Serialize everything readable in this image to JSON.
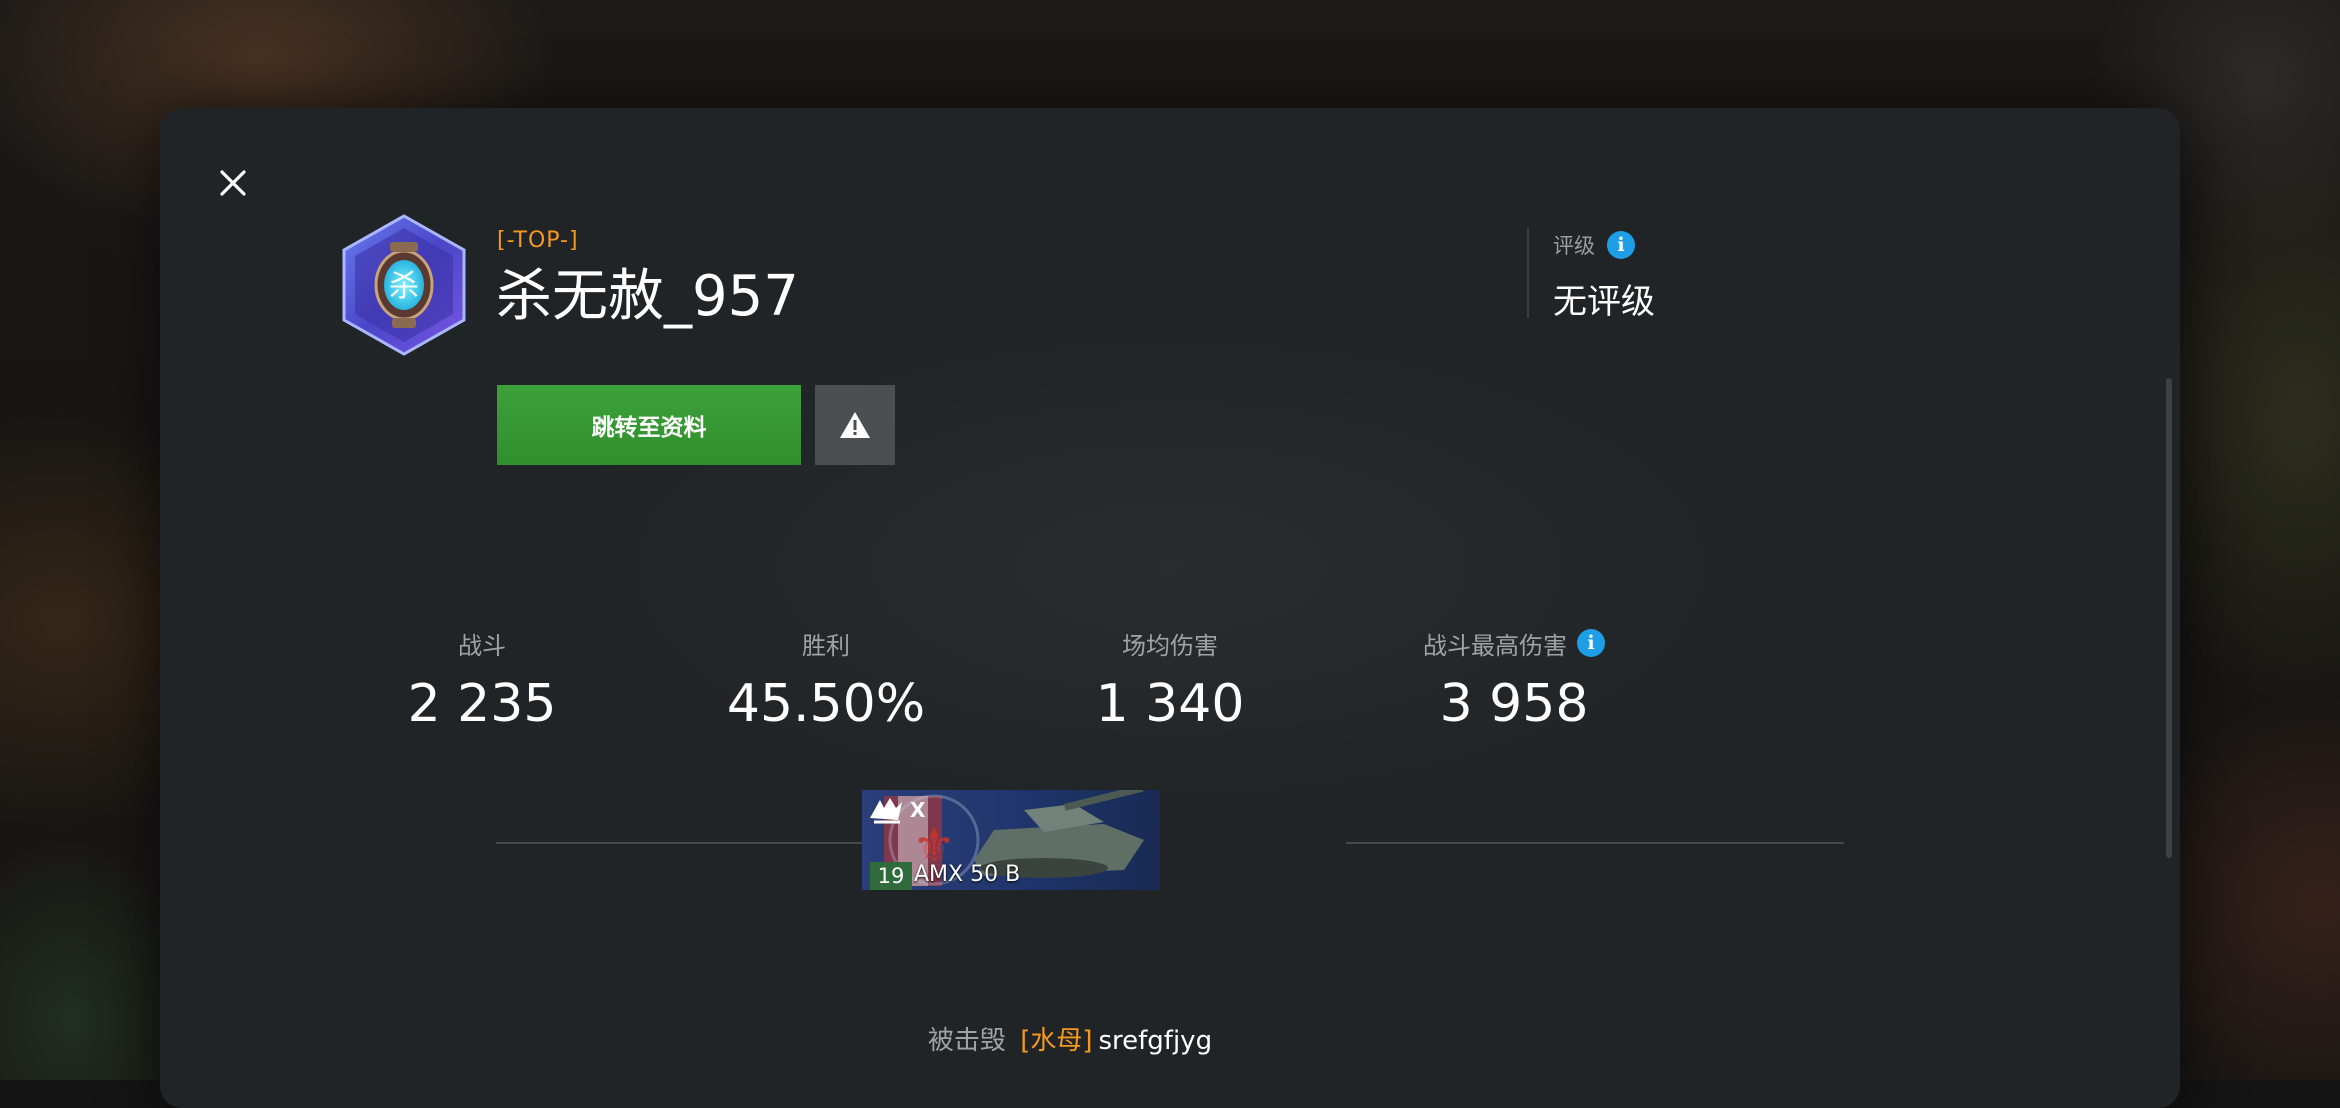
{
  "dialog": {
    "close_icon": "close-icon"
  },
  "player": {
    "clan_tag": "[-TOP-]",
    "name": "杀无赦_957",
    "emblem_icon": "clan-emblem"
  },
  "actions": {
    "profile_button": "跳转至资料",
    "report_icon": "warning-icon"
  },
  "rating": {
    "label": "评级",
    "value": "无评级"
  },
  "stats": [
    {
      "label": "战斗",
      "value": "2 235",
      "has_info": false
    },
    {
      "label": "胜利",
      "value": "45.50%",
      "has_info": false
    },
    {
      "label": "场均伤害",
      "value": "1 340",
      "has_info": false
    },
    {
      "label": "战斗最高伤害",
      "value": "3 958",
      "has_info": true
    }
  ],
  "tank": {
    "tier": "X",
    "level_badge": "19",
    "name": "AMX 50 B",
    "nation": "france"
  },
  "killed_by": {
    "prefix": "被击毁",
    "clan": "[水母]",
    "player": "srefgfjyg"
  },
  "colors": {
    "accent_orange": "#f39a1e",
    "button_green": "#3da13a",
    "info_blue": "#1d9ee6",
    "panel_bg": "#212426"
  }
}
